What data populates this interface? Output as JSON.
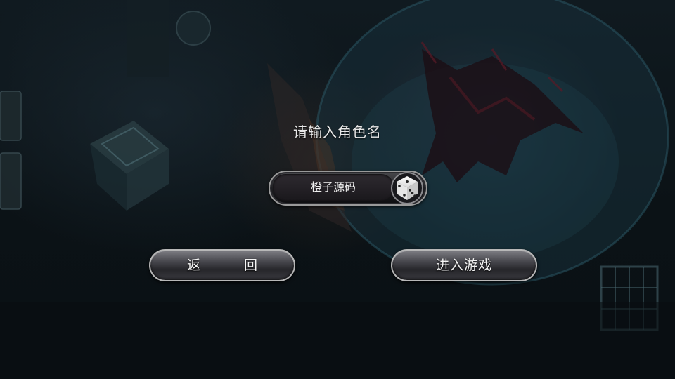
{
  "dialog": {
    "prompt": "请输入角色名",
    "name_value": "橙子源码",
    "back_label": "返 回",
    "enter_label": "进入游戏"
  },
  "icons": {
    "dice": "dice-icon"
  },
  "colors": {
    "text": "#f0f0f0",
    "button_border": "#b8b8b8",
    "background": "#0c1418"
  }
}
